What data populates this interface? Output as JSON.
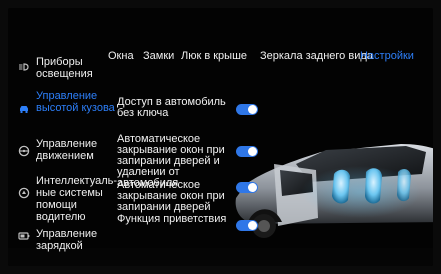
{
  "tabs": [
    {
      "label": "Окна"
    },
    {
      "label": "Замки"
    },
    {
      "label": "Люк в крыше"
    },
    {
      "label": "Зеркала заднего вида"
    },
    {
      "label": "Настройки"
    }
  ],
  "active_tab": "Настройки",
  "sidebar": {
    "items": [
      {
        "label": "Приборы освещения",
        "icon": "headlight-icon"
      },
      {
        "label": "Управление высотой кузова",
        "icon": "car-height-icon"
      },
      {
        "label": "Управление движением",
        "icon": "steering-wheel-icon"
      },
      {
        "label": "Интеллектуаль-ные системы помощи водителю",
        "icon": "driver-assist-icon"
      },
      {
        "label": "Управление зарядкой",
        "icon": "battery-icon"
      }
    ],
    "active_index": 1
  },
  "settings": [
    {
      "label": "Доступ в автомобиль без ключа",
      "enabled": true
    },
    {
      "label": "Автоматическое закрывание окон при запирании дверей и удалении от автомобиля",
      "enabled": true
    },
    {
      "label": "Автоматическое закрывание окон при запирании дверей",
      "enabled": true
    },
    {
      "label": "Функция приветствия",
      "enabled": true
    }
  ],
  "colors": {
    "accent": "#2d7ff9",
    "toggle_on": "#2f77e8",
    "background": "#030303"
  }
}
